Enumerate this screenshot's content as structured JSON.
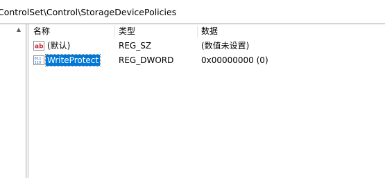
{
  "address": {
    "path": "ControlSet\\Control\\StorageDevicePolicies"
  },
  "list": {
    "headers": {
      "name": "名称",
      "type": "类型",
      "data": "数据"
    },
    "rows": [
      {
        "icon": "string-value-icon",
        "name": "(默认)",
        "type": "REG_SZ",
        "data": "(数值未设置)",
        "selected": false
      },
      {
        "icon": "binary-value-icon",
        "name": "WriteProtect",
        "type": "REG_DWORD",
        "data": "0x00000000 (0)",
        "selected": true
      }
    ]
  },
  "colors": {
    "selection": "#0078d7",
    "string_icon_red": "#c4262e",
    "binary_icon_blue": "#2b6cc4"
  }
}
